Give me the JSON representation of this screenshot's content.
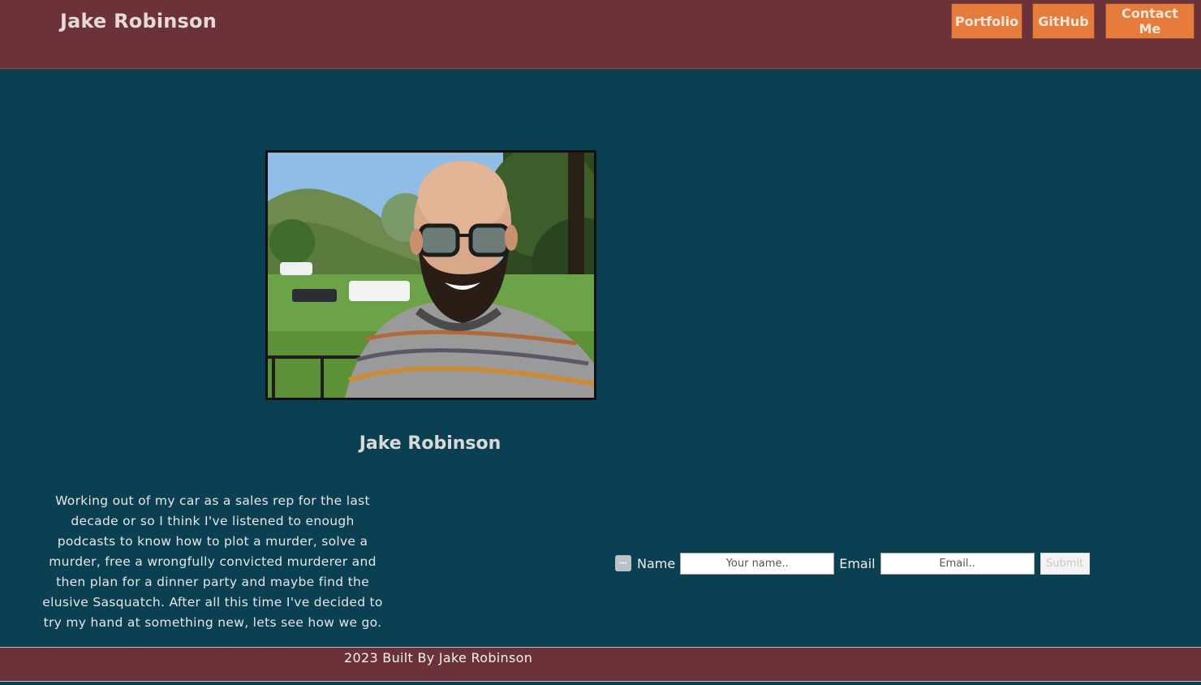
{
  "header": {
    "site_title": "Jake Robinson",
    "nav": {
      "portfolio": "Portfolio",
      "github": "GitHub",
      "contact": "Contact Me"
    }
  },
  "profile": {
    "name": "Jake Robinson",
    "bio": "Working out of my car as a sales rep for the last decade or so I think I've listened to enough podcasts to know how to plot a murder, solve a murder, free a wrongfully convicted murderer and then plan for a dinner party and maybe find the elusive Sasquatch. After all this time I've decided to try my hand at something new, lets see how we go."
  },
  "contact_form": {
    "name_label": "Name",
    "name_placeholder": "Your name..",
    "email_label": "Email",
    "email_placeholder": "Email..",
    "submit_label": "Submit"
  },
  "footer": {
    "text": "2023 Built By Jake Robinson"
  },
  "colors": {
    "header_bg": "#6b3239",
    "page_bg": "#0b3f52",
    "nav_button": "#e57c3b"
  }
}
